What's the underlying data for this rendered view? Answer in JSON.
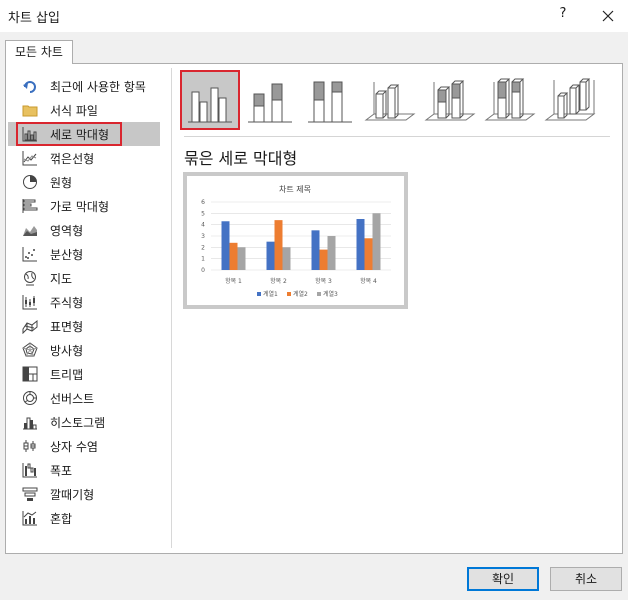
{
  "dialog": {
    "title": "차트 삽입",
    "help": "?"
  },
  "tab": {
    "label": "모든 차트"
  },
  "sidebar": {
    "items": [
      {
        "label": "최근에 사용한 항목",
        "icon": "undo-arrow-icon"
      },
      {
        "label": "서식 파일",
        "icon": "folder-icon"
      },
      {
        "label": "세로 막대형",
        "icon": "column-chart-icon"
      },
      {
        "label": "꺾은선형",
        "icon": "line-chart-icon"
      },
      {
        "label": "원형",
        "icon": "pie-chart-icon"
      },
      {
        "label": "가로 막대형",
        "icon": "bar-chart-icon"
      },
      {
        "label": "영역형",
        "icon": "area-chart-icon"
      },
      {
        "label": "분산형",
        "icon": "scatter-chart-icon"
      },
      {
        "label": "지도",
        "icon": "map-chart-icon"
      },
      {
        "label": "주식형",
        "icon": "stock-chart-icon"
      },
      {
        "label": "표면형",
        "icon": "surface-chart-icon"
      },
      {
        "label": "방사형",
        "icon": "radar-chart-icon"
      },
      {
        "label": "트리맵",
        "icon": "treemap-chart-icon"
      },
      {
        "label": "선버스트",
        "icon": "sunburst-chart-icon"
      },
      {
        "label": "히스토그램",
        "icon": "histogram-chart-icon"
      },
      {
        "label": "상자 수염",
        "icon": "box-whisker-chart-icon"
      },
      {
        "label": "폭포",
        "icon": "waterfall-chart-icon"
      },
      {
        "label": "깔때기형",
        "icon": "funnel-chart-icon"
      },
      {
        "label": "혼합",
        "icon": "combo-chart-icon"
      }
    ],
    "selected_index": 2
  },
  "subtypes": {
    "selected_index": 0,
    "items": [
      "clustered-column-icon",
      "stacked-column-icon",
      "100-stacked-column-icon",
      "3d-clustered-column-icon",
      "3d-stacked-column-icon",
      "3d-100-stacked-column-icon",
      "3d-column-icon"
    ]
  },
  "preview": {
    "subtitle": "묶은 세로 막대형",
    "colors": {
      "series1": "#4472c4",
      "series2": "#ed7d31",
      "series3": "#a5a5a5"
    },
    "chart_data": {
      "type": "bar",
      "title": "차트 제목",
      "categories": [
        "항목 1",
        "항목 2",
        "항목 3",
        "항목 4"
      ],
      "series": [
        {
          "name": "계열1",
          "values": [
            4.3,
            2.5,
            3.5,
            4.5
          ]
        },
        {
          "name": "계열2",
          "values": [
            2.4,
            4.4,
            1.8,
            2.8
          ]
        },
        {
          "name": "계열3",
          "values": [
            2,
            2,
            3,
            5
          ]
        }
      ],
      "yticks": [
        "0",
        "1",
        "2",
        "3",
        "4",
        "5",
        "6"
      ],
      "ylim": [
        0,
        6
      ],
      "grid": true,
      "legend": "bottom"
    }
  },
  "buttons": {
    "ok": "확인",
    "cancel": "취소"
  }
}
